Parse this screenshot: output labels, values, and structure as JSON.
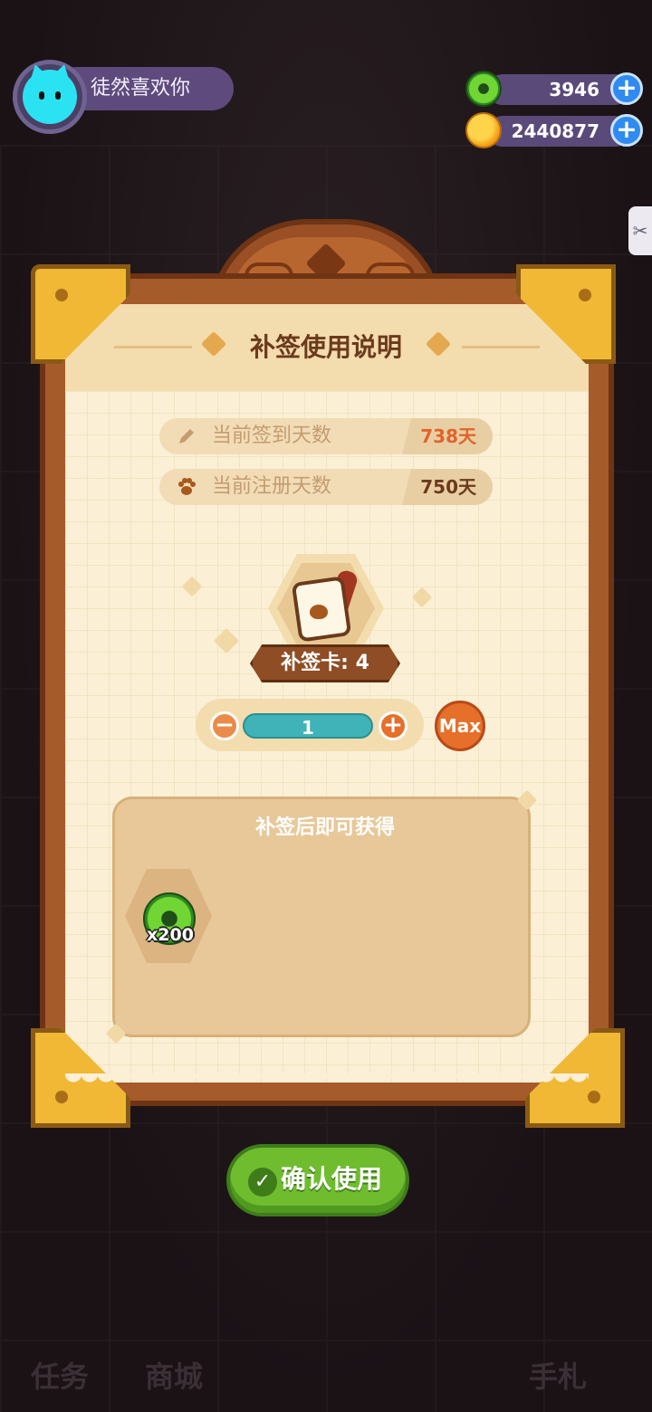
{
  "player": {
    "name": "徒然喜欢你"
  },
  "currencies": [
    {
      "icon": "green-donut-coin-icon",
      "amount": "3946"
    },
    {
      "icon": "gold-planet-coin-icon",
      "amount": "2440877"
    }
  ],
  "dialog": {
    "title": "补签使用说明",
    "stats": [
      {
        "label": "当前签到天数",
        "value": "738天",
        "icon": "pencil-icon",
        "value_color": "#e2632a"
      },
      {
        "label": "当前注册天数",
        "value": "750天",
        "icon": "paw-icon",
        "value_color": "#6b3a1c"
      }
    ],
    "card": {
      "label": "补签卡: 4"
    },
    "stepper": {
      "value": "1",
      "max_label": "Max"
    },
    "reward": {
      "title": "补签后即可获得",
      "items": [
        {
          "icon": "green-donut-coin-icon",
          "quantity": "x200"
        }
      ]
    }
  },
  "confirm_button": {
    "label": "确认使用"
  },
  "background": {
    "labels": [
      "任务",
      "商城",
      "手札"
    ]
  }
}
